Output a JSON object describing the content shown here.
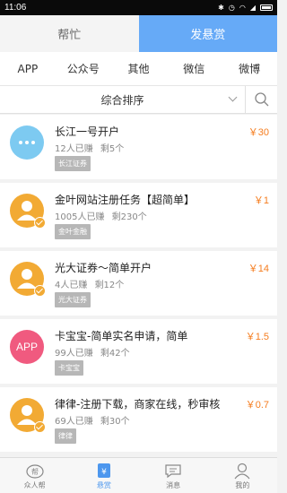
{
  "statusbar": {
    "time": "11:06"
  },
  "top_tabs": [
    {
      "label": "帮忙",
      "active": false
    },
    {
      "label": "发悬赏",
      "active": true
    }
  ],
  "categories": [
    "APP",
    "公众号",
    "其他",
    "微信",
    "微博"
  ],
  "sort": {
    "label": "综合排序"
  },
  "items": [
    {
      "title": "长江一号开户",
      "earned": "12人已赚",
      "remaining": "剩5个",
      "tag": "长江证券",
      "price": "￥30",
      "avatar": "dots"
    },
    {
      "title": "金叶网站注册任务【超简单】",
      "earned": "1005人已赚",
      "remaining": "剩230个",
      "tag": "金叶金融",
      "price": "￥1",
      "avatar": "user"
    },
    {
      "title": "光大证券～简单开户",
      "earned": "4人已赚",
      "remaining": "剩12个",
      "tag": "光大证券",
      "price": "￥14",
      "avatar": "user"
    },
    {
      "title": "卡宝宝-简单实名申请，简单",
      "earned": "99人已赚",
      "remaining": "剩42个",
      "tag": "卡宝宝",
      "price": "￥1.5",
      "avatar": "app",
      "avatar_text": "APP"
    },
    {
      "title": "律律-注册下载，商家在线，秒审核",
      "earned": "69人已赚",
      "remaining": "剩30个",
      "tag": "律律",
      "price": "￥0.7",
      "avatar": "user"
    }
  ],
  "bottom_nav": [
    {
      "label": "众人帮",
      "active": false
    },
    {
      "label": "悬赏",
      "active": true
    },
    {
      "label": "消息",
      "active": false
    },
    {
      "label": "我的",
      "active": false
    }
  ],
  "colors": {
    "accent": "#66aaf7",
    "price": "#f57d1f",
    "avatar_blue": "#7dcaf1",
    "avatar_orange": "#f2aa34",
    "avatar_pink": "#f05a7f"
  }
}
